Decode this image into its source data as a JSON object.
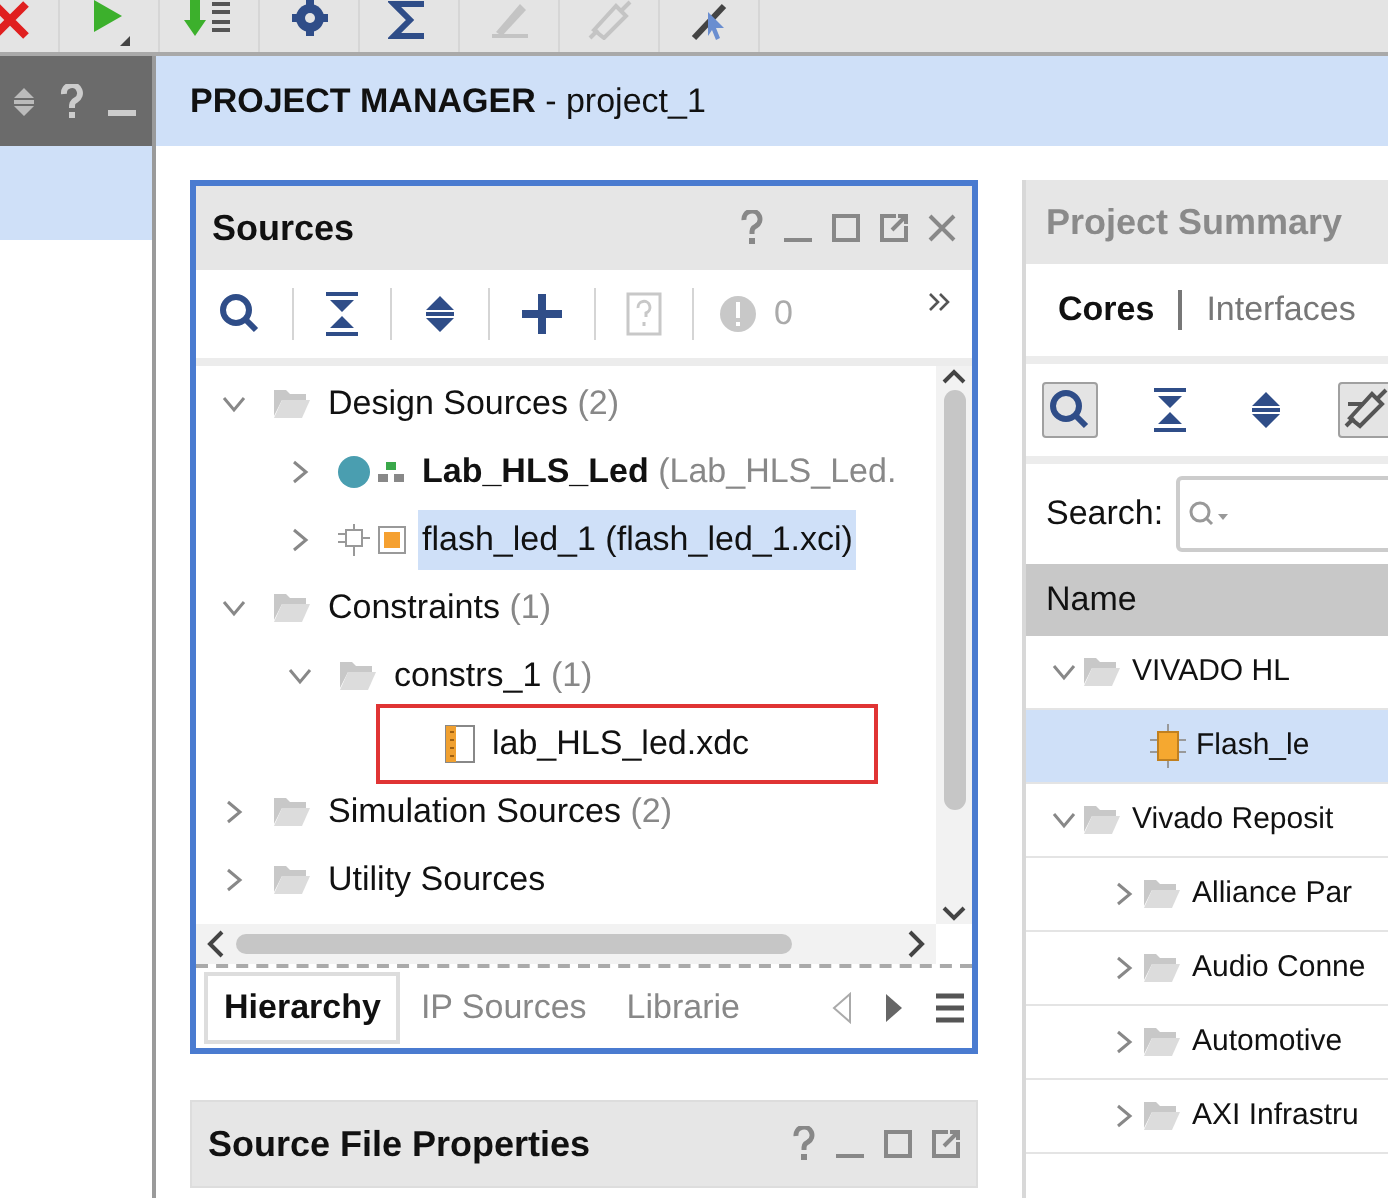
{
  "toolbar": [
    {
      "kind": "stop",
      "disabled": false
    },
    {
      "kind": "run",
      "disabled": false
    },
    {
      "kind": "program",
      "disabled": false
    },
    {
      "kind": "settings",
      "disabled": false
    },
    {
      "kind": "sum",
      "disabled": false
    },
    {
      "kind": "pen",
      "disabled": true
    },
    {
      "kind": "probe",
      "disabled": true
    },
    {
      "kind": "cursor",
      "disabled": false
    }
  ],
  "flow_navigator": {
    "item_selected": true
  },
  "header": {
    "title": "**PROJECT MANAGER** - project_1"
  },
  "sources": {
    "title": "Sources",
    "toolbar": [
      {
        "kind": "search",
        "disabled": false
      },
      {
        "kind": "collapse",
        "disabled": false
      },
      {
        "kind": "expand",
        "disabled": false
      },
      {
        "kind": "add",
        "disabled": false
      },
      {
        "kind": "doc",
        "disabled": true
      }
    ],
    "messages": {
      "count": "0"
    },
    "tree": [
      {
        "label": "Design Sources",
        "count": "(2)",
        "kind": "folder",
        "expanded": true,
        "selected": false,
        "children": [
          {
            "label": "Lab_HLS_Led",
            "detail": "(Lab_HLS_Led.",
            "bold": true,
            "kind": "module",
            "expanded": false,
            "selected": false
          },
          {
            "label": "flash_led_1 (flash_led_1.xci)",
            "kind": "ip",
            "expanded": false,
            "selected": true
          }
        ]
      },
      {
        "label": "Constraints",
        "count": "(1)",
        "kind": "folder",
        "expanded": true,
        "selected": false,
        "children": [
          {
            "label": "constrs_1",
            "count": "(1)",
            "kind": "folder",
            "expanded": true,
            "selected": false,
            "children": [
              {
                "label": "lab_HLS_led.xdc",
                "kind": "xdc",
                "selected": false,
                "outlined": true
              }
            ]
          }
        ]
      },
      {
        "label": "Simulation Sources",
        "count": "(2)",
        "kind": "folder",
        "expanded": false,
        "selected": false
      },
      {
        "label": "Utility Sources",
        "kind": "folder",
        "expanded": false,
        "selected": false
      }
    ],
    "tabs": [
      {
        "label": "Hierarchy",
        "selected": true
      },
      {
        "label": "IP Sources",
        "selected": false
      },
      {
        "label": "Librarie",
        "selected": false
      }
    ]
  },
  "source_file_properties": {
    "title": "Source File Properties"
  },
  "project_summary": {
    "title": "Project Summary",
    "tabs": [
      {
        "label": "Cores",
        "selected": true
      },
      {
        "label": "Interfaces",
        "selected": false
      }
    ],
    "toolbar": [
      {
        "kind": "search",
        "pressed": true
      },
      {
        "kind": "collapse",
        "pressed": false
      },
      {
        "kind": "expand",
        "pressed": false
      },
      {
        "kind": "probe",
        "pressed": true
      }
    ],
    "search": {
      "label": "Search:"
    },
    "table": {
      "columns": [
        "Name"
      ],
      "rows": [
        {
          "label": "VIVADO HL",
          "kind": "folder",
          "expanded": true,
          "selected": false,
          "children": [
            {
              "label": "Flash_le",
              "kind": "core",
              "selected": true
            }
          ]
        },
        {
          "label": "Vivado Reposit",
          "kind": "folder",
          "expanded": true,
          "selected": false,
          "children": [
            {
              "label": "Alliance Par",
              "kind": "folder",
              "expanded": false,
              "selected": false
            },
            {
              "label": "Audio Conne",
              "kind": "folder",
              "expanded": false,
              "selected": false
            },
            {
              "label": "Automotive",
              "kind": "folder",
              "expanded": false,
              "selected": false
            },
            {
              "label": "AXI Infrastru",
              "kind": "folder",
              "expanded": false,
              "selected": false
            }
          ]
        }
      ]
    }
  }
}
